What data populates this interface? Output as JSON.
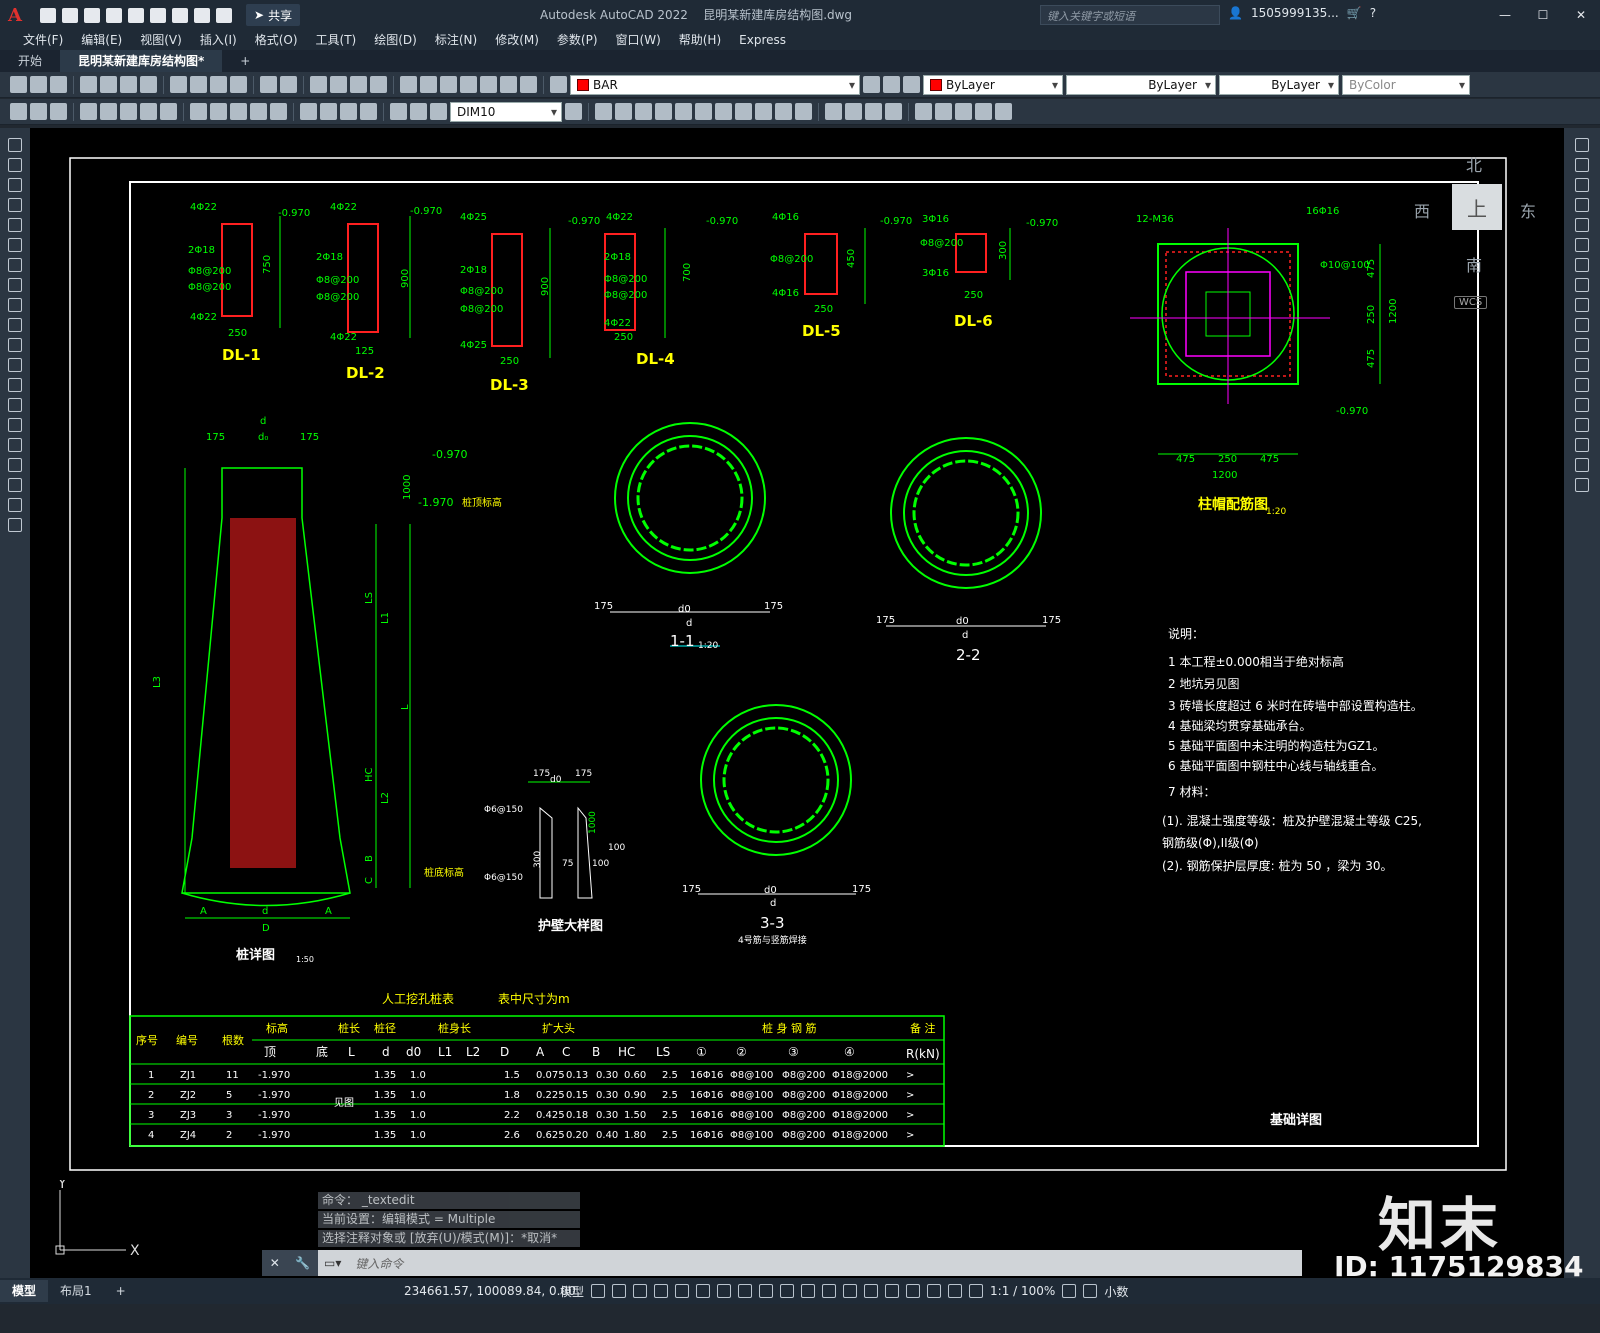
{
  "titlebar": {
    "app_logo": "A",
    "share_label": "共享",
    "app_name": "Autodesk AutoCAD 2022",
    "file_name": "昆明某新建库房结构图.dwg",
    "search_placeholder": "键入关键字或短语",
    "user": "1505999135...",
    "help": "?"
  },
  "menu": [
    "文件(F)",
    "编辑(E)",
    "视图(V)",
    "插入(I)",
    "格式(O)",
    "工具(T)",
    "绘图(D)",
    "标注(N)",
    "修改(M)",
    "参数(P)",
    "窗口(W)",
    "帮助(H)",
    "Express"
  ],
  "tabs": {
    "start": "开始",
    "active": "昆明某新建库房结构图*",
    "add": "+"
  },
  "toolbar": {
    "layer": "BAR",
    "color": "ByLayer",
    "linetype": "ByLayer",
    "lineweight": "ByLayer",
    "plotstyle": "ByColor",
    "dimstyle": "DIM10"
  },
  "viewcube": {
    "north": "北",
    "south": "南",
    "east": "东",
    "west": "西",
    "face": "上",
    "wcs": "WCS"
  },
  "drawing": {
    "beams": [
      "DL-1",
      "DL-2",
      "DL-3",
      "DL-4",
      "DL-5",
      "DL-6"
    ],
    "beam_dims": {
      "dl1": [
        "4Φ22",
        "2Φ18",
        "Φ8@200",
        "Φ8@200",
        "4Φ22",
        "250",
        "750",
        "-0.970"
      ],
      "dl2": [
        "4Φ22",
        "2Φ18",
        "Φ8@200",
        "Φ8@200",
        "4Φ22",
        "125",
        "900",
        "-0.970"
      ],
      "dl3": [
        "4Φ25",
        "2Φ18",
        "Φ8@200",
        "Φ8@200",
        "4Φ25",
        "250",
        "900",
        "-0.970"
      ],
      "dl4": [
        "4Φ22",
        "2Φ18",
        "Φ8@200",
        "Φ8@200",
        "4Φ22",
        "250",
        "700",
        "-0.970"
      ],
      "dl5": [
        "4Φ16",
        "Φ8@200",
        "4Φ16",
        "250",
        "450",
        "-0.970"
      ],
      "dl6": [
        "3Φ16",
        "Φ8@200",
        "3Φ16",
        "250",
        "300",
        "-0.970"
      ]
    },
    "cap_title": "柱帽配筋图",
    "cap_scale": "1:20",
    "cap_labels": [
      "12-M36",
      "16Φ16",
      "Φ10@100",
      "475",
      "250",
      "475",
      "1200",
      "1200",
      "475",
      "250",
      "475",
      "-0.970"
    ],
    "pile_title": "桩详图",
    "pile_scale": "1:50",
    "pile_labels": [
      "d",
      "d₀",
      "175",
      "175",
      "-0.970",
      "-1.970",
      "桩顶标高",
      "1000",
      "LS",
      "L1",
      "L3",
      "L",
      "HC",
      "L2",
      "B",
      "C",
      "桩底标高",
      "A",
      "d",
      "A",
      "D"
    ],
    "wall_title": "护壁大样图",
    "wall_labels": [
      "175",
      "d0",
      "175",
      "Φ6@150",
      "Φ6@150",
      "1000",
      "300",
      "75",
      "100",
      "100"
    ],
    "sections": [
      {
        "name": "1-1",
        "scale": "1:20",
        "labels": [
          "175",
          "d0",
          "d",
          "175"
        ]
      },
      {
        "name": "2-2",
        "scale": "",
        "labels": [
          "175",
          "d0",
          "d",
          "175"
        ]
      },
      {
        "name": "3-3",
        "scale": "",
        "labels": [
          "175",
          "d0",
          "d",
          "175"
        ],
        "note": "4号筋与竖筋焊接"
      }
    ],
    "notes": {
      "heading": "说明：",
      "items": [
        "1  本工程±0.000相当于绝对标高",
        "2  地坑另见图",
        "3  砖墙长度超过 6 米时在砖墙中部设置构造柱。",
        "4  基础梁均贯穿基础承台。",
        "5  基础平面图中未注明的构造柱为GZ1。",
        "6  基础平面图中钢柱中心线与轴线重合。",
        "7  材料：",
        "(1). 混凝土强度等级：桩及护壁混凝土等级 C25,",
        "      钢筋级(Φ),II级(Φ)",
        "(2). 钢筋保护层厚度: 桩为 50 ，梁为 30。"
      ]
    },
    "sheet_title": "基础详图",
    "table": {
      "title": "人工挖孔桩表",
      "unit_note": "表中尺寸为m",
      "headers_top": [
        "序号",
        "编号",
        "根数",
        "标高",
        "桩长",
        "桩径",
        "桩身长",
        "扩大头",
        "桩 身 钢 筋",
        "备 注"
      ],
      "headers_sub": [
        "顶",
        "底",
        "L",
        "d",
        "d0",
        "L1",
        "L2",
        "D",
        "A",
        "C",
        "B",
        "HC",
        "LS",
        "①",
        "②",
        "③",
        "④",
        "R(kN)"
      ],
      "rows": [
        [
          "1",
          "ZJ1",
          "11",
          "-1.970",
          "",
          "1.35",
          "1.0",
          "",
          "",
          "1.5",
          "0.075",
          "0.13",
          "0.30",
          "0.60",
          "2.5",
          "16Φ16",
          "Φ8@100",
          "Φ8@200",
          "Φ18@2000",
          ">"
        ],
        [
          "2",
          "ZJ2",
          "5",
          "-1.970",
          "",
          "1.35",
          "1.0",
          "",
          "",
          "1.8",
          "0.225",
          "0.15",
          "0.30",
          "0.90",
          "2.5",
          "16Φ16",
          "Φ8@100",
          "Φ8@200",
          "Φ18@2000",
          ">"
        ],
        [
          "3",
          "ZJ3",
          "3",
          "-1.970",
          "",
          "1.35",
          "1.0",
          "",
          "",
          "2.2",
          "0.425",
          "0.18",
          "0.30",
          "1.50",
          "2.5",
          "16Φ16",
          "Φ8@100",
          "Φ8@200",
          "Φ18@2000",
          ">"
        ],
        [
          "4",
          "ZJ4",
          "2",
          "-1.970",
          "",
          "1.35",
          "1.0",
          "",
          "",
          "2.6",
          "0.625",
          "0.20",
          "0.40",
          "1.80",
          "2.5",
          "16Φ16",
          "Φ8@100",
          "Φ8@200",
          "Φ18@2000",
          ">"
        ]
      ],
      "merged_note": "见图"
    }
  },
  "command": {
    "history": [
      "命令： _textedit",
      "当前设置：编辑模式 = Multiple",
      "选择注释对象或 [放弃(U)/模式(M)]：*取消*"
    ],
    "prompt": "键入命令"
  },
  "status": {
    "tabs": [
      "模型",
      "布局1",
      "+"
    ],
    "coords": "234661.57, 100089.84, 0.00",
    "mode": "模型",
    "scale": "1:1 / 100%",
    "units": "小数"
  },
  "watermark": {
    "brand": "知末",
    "id": "ID: 1175129834"
  },
  "colors": {
    "bg": "#000000",
    "green": "#00ff00",
    "red": "#ff2020",
    "yellow": "#ffff00",
    "magenta": "#ff00ff",
    "cyan": "#00ffff",
    "white": "#ffffff"
  }
}
